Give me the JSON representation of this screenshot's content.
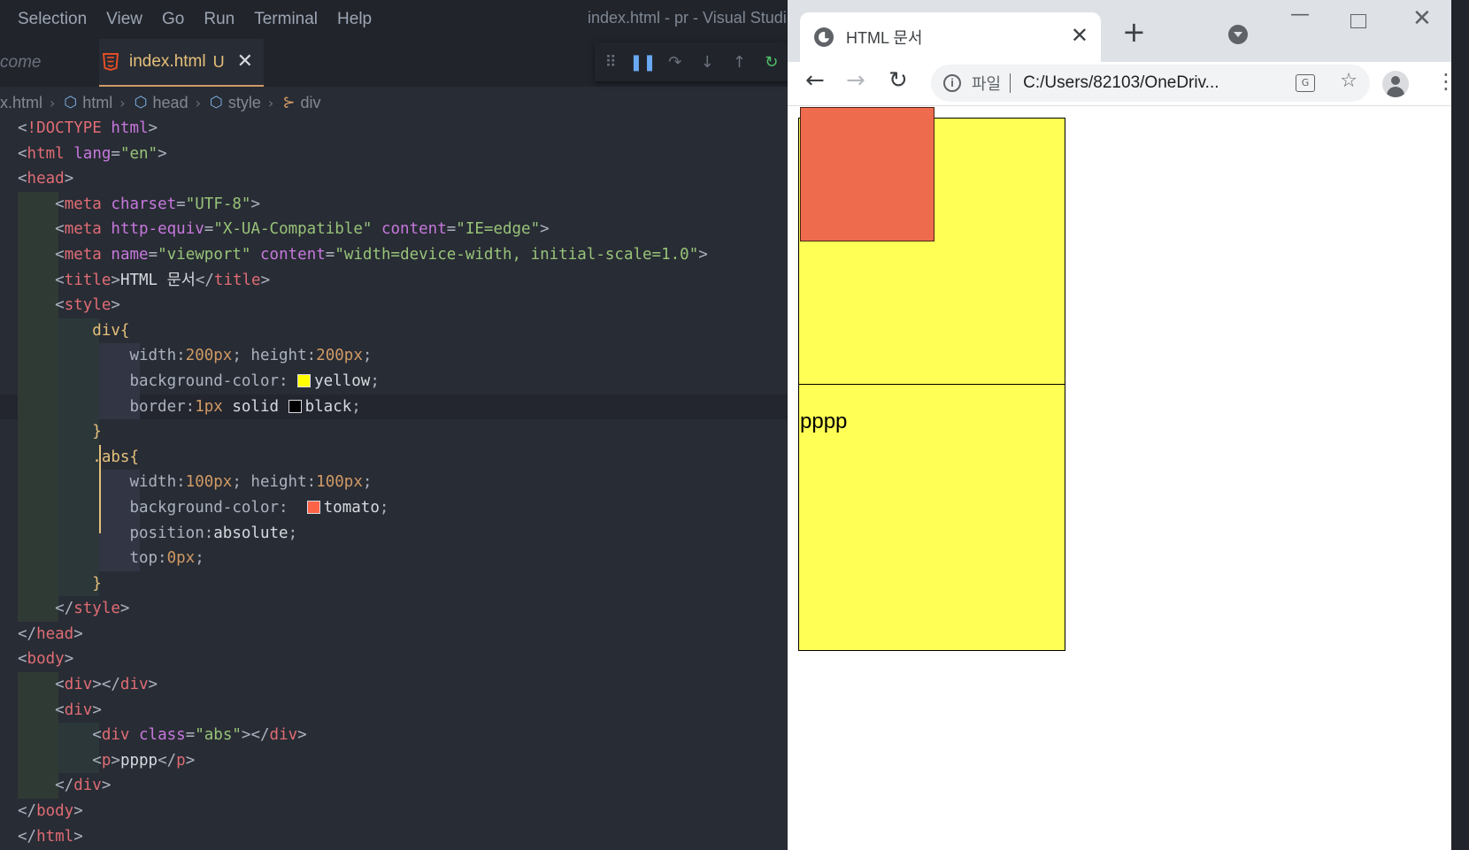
{
  "vscode": {
    "menu": [
      "Selection",
      "View",
      "Go",
      "Run",
      "Terminal",
      "Help"
    ],
    "window_title": "index.html - pr - Visual Studi",
    "tabs": {
      "inactive_label": "come",
      "active_label": "index.html",
      "active_status": "U"
    },
    "breadcrumb": {
      "file": "lex.html",
      "items": [
        "html",
        "head",
        "style",
        "div"
      ]
    }
  },
  "chrome": {
    "tab_title": "HTML 문서",
    "omnibox": {
      "scheme_label": "파일",
      "url": "C:/Users/82103/OneDriv..."
    },
    "page": {
      "paragraph_text": "pppp"
    }
  }
}
